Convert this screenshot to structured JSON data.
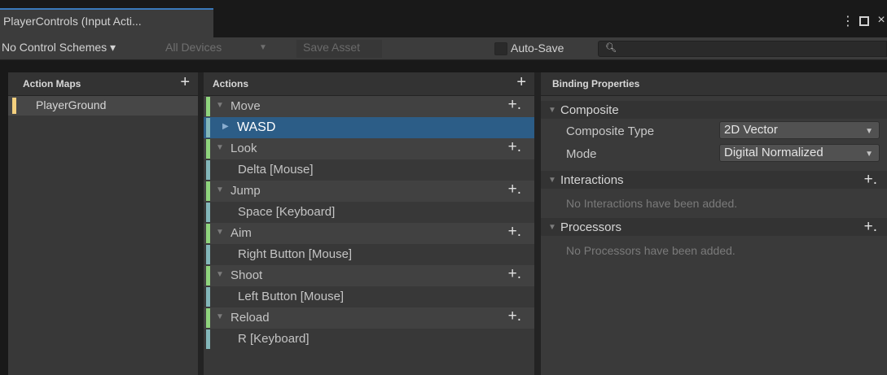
{
  "window": {
    "tab_title": "PlayerControls (Input Acti...",
    "menu_glyph": "⋮",
    "close_glyph": "×"
  },
  "toolbar": {
    "schemes_label": "No Control Schemes ▾",
    "devices_label": "All Devices",
    "save_asset_label": "Save Asset",
    "autosave_label": "Auto-Save",
    "autosave_checked": false,
    "search_placeholder": ""
  },
  "action_maps": {
    "header": "Action Maps",
    "items": [
      {
        "label": "PlayerGround",
        "color": "#f4d07e",
        "selected": true
      }
    ]
  },
  "actions": {
    "header": "Actions",
    "rows": [
      {
        "type": "action",
        "label": "Move"
      },
      {
        "type": "composite",
        "label": "WASD",
        "selected": true
      },
      {
        "type": "action",
        "label": "Look"
      },
      {
        "type": "binding",
        "label": "Delta [Mouse]"
      },
      {
        "type": "action",
        "label": "Jump"
      },
      {
        "type": "binding",
        "label": "Space [Keyboard]"
      },
      {
        "type": "action",
        "label": "Aim"
      },
      {
        "type": "binding",
        "label": "Right Button [Mouse]"
      },
      {
        "type": "action",
        "label": "Shoot"
      },
      {
        "type": "binding",
        "label": "Left Button [Mouse]"
      },
      {
        "type": "action",
        "label": "Reload"
      },
      {
        "type": "binding",
        "label": "R [Keyboard]"
      }
    ]
  },
  "binding_properties": {
    "header": "Binding Properties",
    "composite": {
      "title": "Composite",
      "composite_type_label": "Composite Type",
      "composite_type_value": "2D Vector",
      "mode_label": "Mode",
      "mode_value": "Digital Normalized"
    },
    "interactions": {
      "title": "Interactions",
      "empty_text": "No Interactions have been added."
    },
    "processors": {
      "title": "Processors",
      "empty_text": "No Processors have been added."
    }
  },
  "colors": {
    "action_map_accent": "#f4d07e",
    "action_accent": "#8fd47d",
    "binding_accent": "#83b7ba",
    "selection": "#2c5d87",
    "tab_accent": "#3a79bb"
  }
}
